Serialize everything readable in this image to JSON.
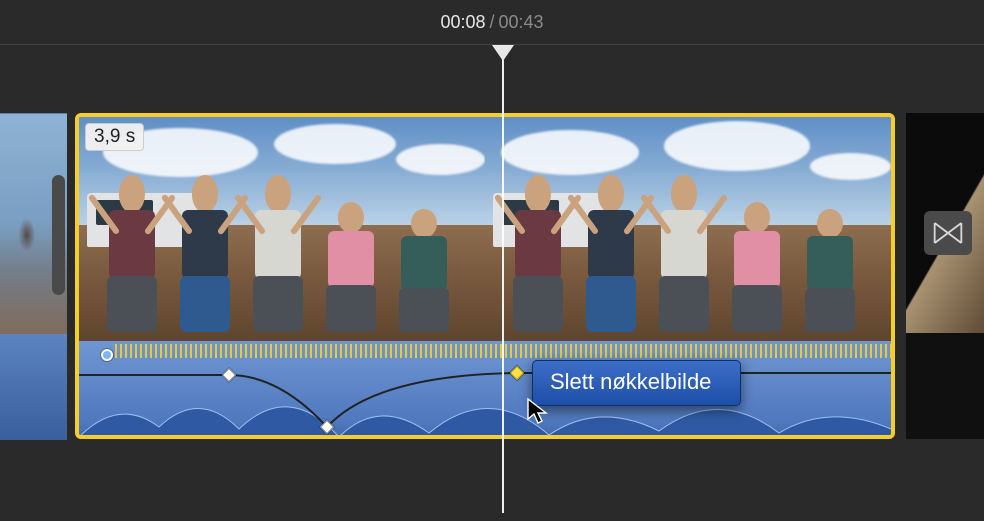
{
  "timecode": {
    "current": "00:08",
    "separator": "/",
    "total": "00:43"
  },
  "clip": {
    "duration_label": "3,9 s"
  },
  "audio": {
    "keyframes": [
      {
        "x_pct": 18.5,
        "y_pct": 22,
        "active": false
      },
      {
        "x_pct": 30.5,
        "y_pct": 86,
        "active": false
      },
      {
        "x_pct": 54.0,
        "y_pct": 20,
        "active": true
      }
    ]
  },
  "context_menu": {
    "items": [
      "Slett nøkkelbilde"
    ]
  },
  "icons": {
    "transition": "transition-bowtie-icon"
  }
}
